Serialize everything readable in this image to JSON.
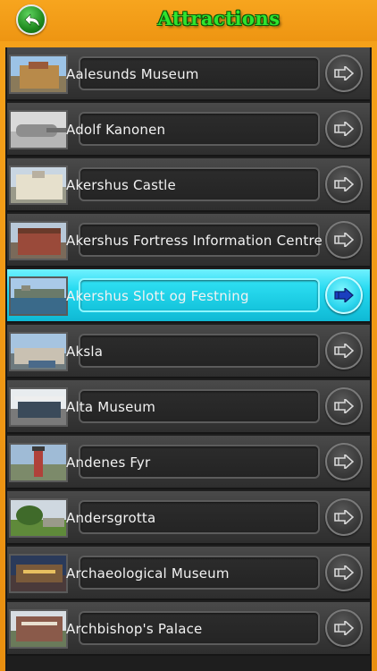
{
  "header": {
    "title": "Attractions",
    "back_icon": "back-arrow-icon",
    "back_color": "#2a9d2a",
    "title_color": "#2ee42e"
  },
  "colors": {
    "header_bg": "#f29a18",
    "row_bg": "#3c3c3c",
    "selected_bg": "#24d9f0",
    "selected_arrow": "#1a3fbf"
  },
  "list": {
    "items": [
      {
        "label": "Aalesunds Museum",
        "thumb": "museum-building-photo",
        "selected": false
      },
      {
        "label": "Adolf Kanonen",
        "thumb": "cannon-photo",
        "selected": false
      },
      {
        "label": "Akershus Castle",
        "thumb": "castle-photo",
        "selected": false
      },
      {
        "label": "Akershus Fortress Information Centre",
        "thumb": "fortress-building-photo",
        "selected": false
      },
      {
        "label": "Akershus Slott og Festning",
        "thumb": "harbor-fortress-photo",
        "selected": true
      },
      {
        "label": "Aksla",
        "thumb": "city-view-photo",
        "selected": false
      },
      {
        "label": "Alta Museum",
        "thumb": "museum-entrance-photo",
        "selected": false
      },
      {
        "label": "Andenes Fyr",
        "thumb": "lighthouse-photo",
        "selected": false
      },
      {
        "label": "Andersgrotta",
        "thumb": "grotto-park-photo",
        "selected": false
      },
      {
        "label": "Archaeological Museum",
        "thumb": "museum-night-photo",
        "selected": false
      },
      {
        "label": "Archbishop's Palace",
        "thumb": "palace-photo",
        "selected": false
      }
    ],
    "row_icon": "next-arrow-icon"
  }
}
